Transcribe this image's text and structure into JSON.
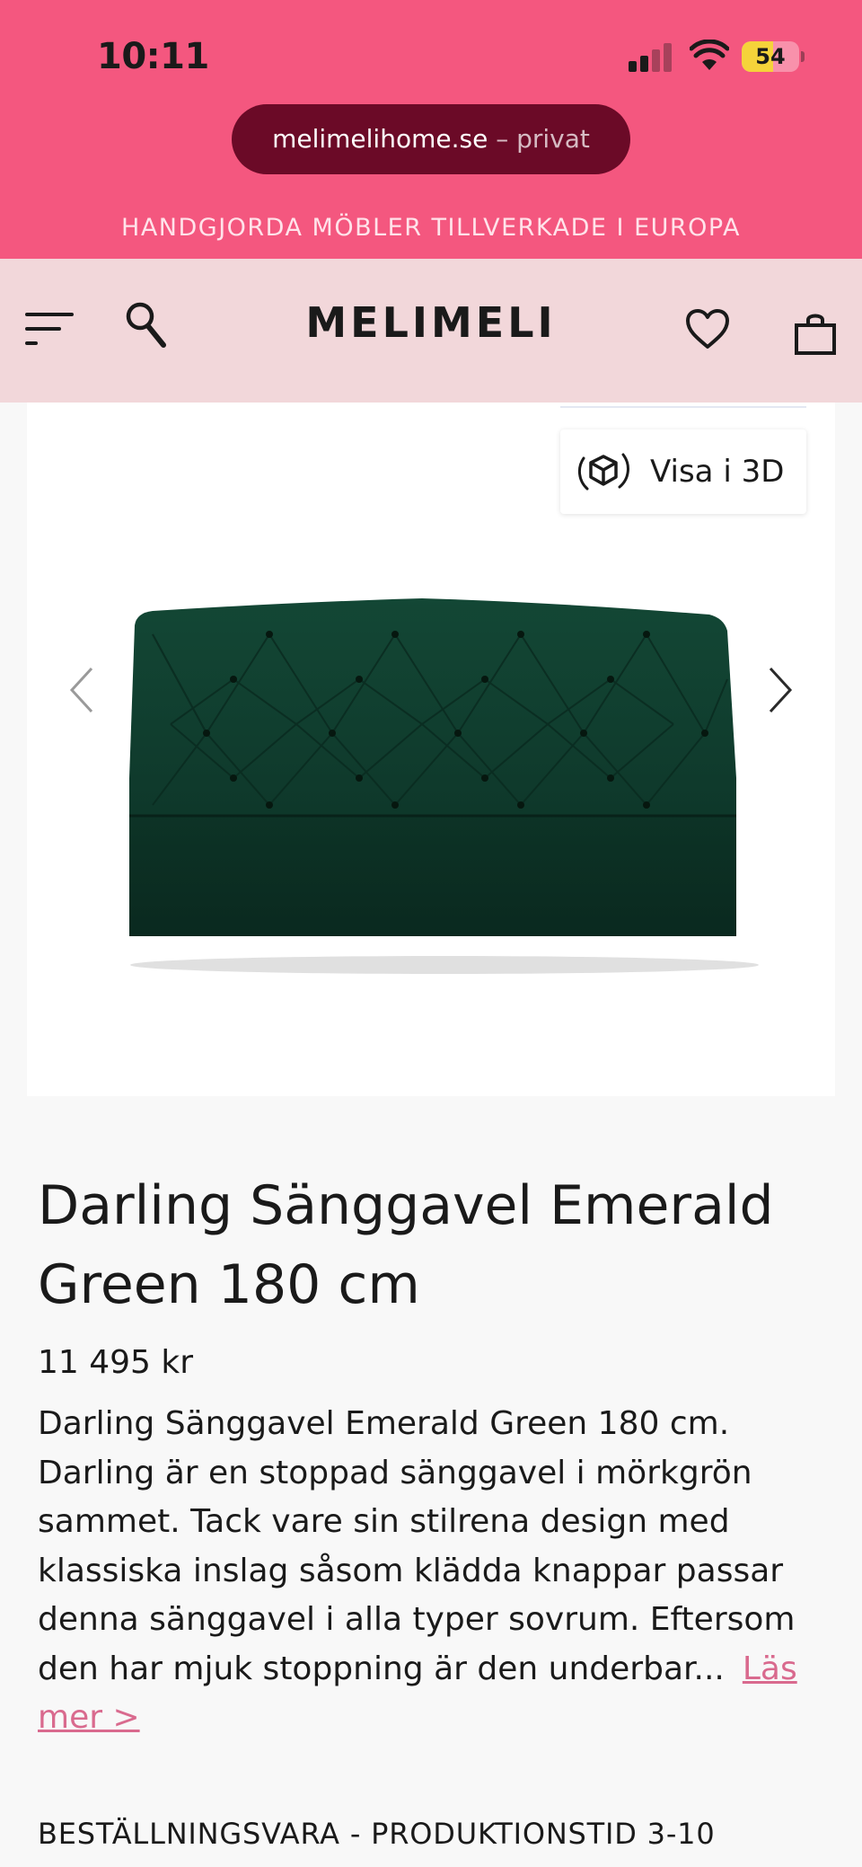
{
  "status_bar": {
    "time": "10:11",
    "battery": "54",
    "battery_level": 0.54
  },
  "browser": {
    "domain": "melimelihome.se",
    "privacy_label": "– privat"
  },
  "promo_banner": "HANDGJORDA MÖBLER TILLVERKADE I EUROPA",
  "header": {
    "logo": "MELIMELI",
    "icons": [
      "menu-icon",
      "search-icon",
      "heart-icon",
      "bag-icon"
    ]
  },
  "gallery": {
    "view_3d_label": "Visa i 3D",
    "icons": [
      "3d-cube-icon",
      "chevron-left-icon",
      "chevron-right-icon"
    ]
  },
  "product": {
    "title": "Darling Sänggavel Emerald Green 180 cm",
    "price": "11 495 kr",
    "description": "Darling Sänggavel Emerald Green 180 cm. Darling är en stoppad sänggavel i mörkgrön sammet. Tack vare sin stilrena design med klassiska inslag såsom klädda knappar passar denna sänggavel i alla typer sovrum. Eftersom den har mjuk stoppning är den underbar...",
    "read_more": "Läs mer >",
    "lead_time": "BESTÄLLNINGSVARA - PRODUKTIONSTID 3-10"
  },
  "colors": {
    "top_bar": "#f4577f",
    "url_pill": "#6b0a27",
    "header_bg": "#f2d7da",
    "link": "#d96a8e",
    "headboard": "#0f3a2c"
  }
}
